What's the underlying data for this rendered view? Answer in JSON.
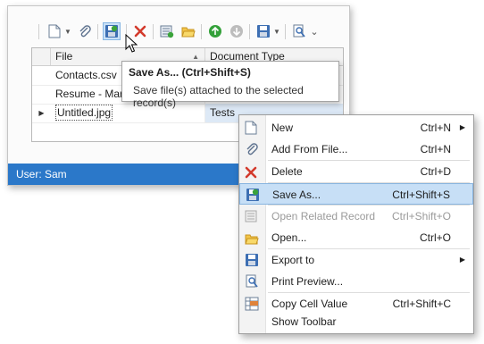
{
  "toolbar": {
    "icons": [
      "new-doc-icon",
      "dropdown-arrow-icon",
      "paperclip-icon",
      "save-as-icon",
      "delete-icon",
      "open-related-icon",
      "open-folder-icon",
      "refresh-icon",
      "refresh-disabled-icon",
      "export-icon",
      "dropdown-arrow-icon",
      "print-preview-icon",
      "chevron-down-icon"
    ]
  },
  "grid": {
    "columns": [
      "File",
      "Document Type"
    ],
    "rows": [
      {
        "file": "Contacts.csv",
        "type": ""
      },
      {
        "file": "Resume - Mary",
        "type": ""
      },
      {
        "file": "Untitled.jpg",
        "type": "Tests"
      }
    ]
  },
  "status": {
    "text": "User: Sam"
  },
  "tooltip": {
    "title": "Save As... (Ctrl+Shift+S)",
    "description": "Save file(s) attached to the selected record(s)"
  },
  "menu": {
    "items": [
      {
        "label": "New",
        "shortcut": "Ctrl+N",
        "icon": "new-doc-icon",
        "submenu": true
      },
      {
        "label": "Add From File...",
        "shortcut": "Ctrl+N",
        "icon": "paperclip-icon"
      },
      {
        "label": "Delete",
        "shortcut": "Ctrl+D",
        "icon": "delete-icon"
      },
      {
        "label": "Save As...",
        "shortcut": "Ctrl+Shift+S",
        "icon": "save-as-icon",
        "highlighted": true
      },
      {
        "label": "Open Related Record",
        "shortcut": "Ctrl+Shift+O",
        "icon": "open-related-icon",
        "disabled": true
      },
      {
        "label": "Open...",
        "shortcut": "Ctrl+O",
        "icon": "open-folder-icon"
      },
      {
        "label": "Export to",
        "shortcut": "",
        "icon": "export-icon",
        "submenu": true
      },
      {
        "label": "Print Preview...",
        "shortcut": "",
        "icon": "print-preview-icon"
      },
      {
        "label": "Copy Cell Value",
        "shortcut": "Ctrl+Shift+C",
        "icon": "copy-cell-icon"
      },
      {
        "label": "Show Toolbar",
        "shortcut": "",
        "icon": ""
      }
    ]
  },
  "colors": {
    "status_bar": "#2b78c9",
    "highlight": "#c7dff6",
    "delete_red": "#d33a2c"
  }
}
